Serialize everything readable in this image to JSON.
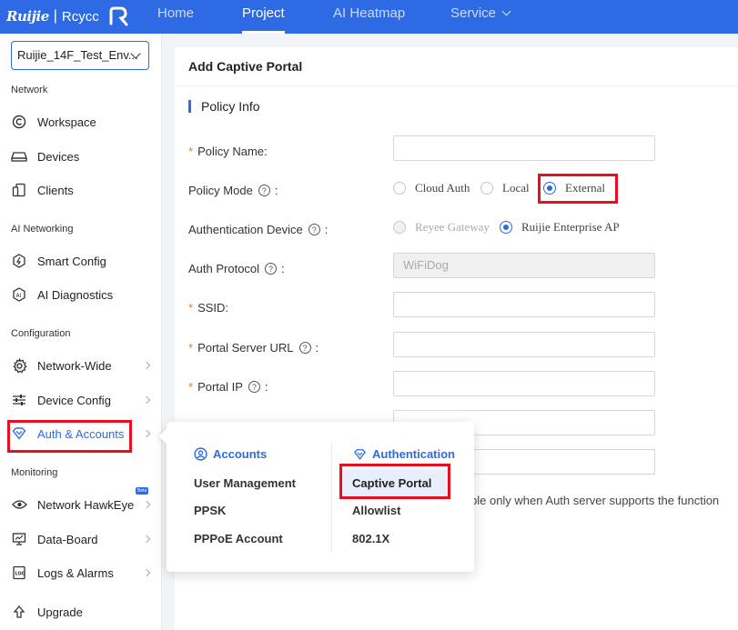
{
  "topbar": {
    "brand": "Ruijie",
    "brand2": "Rcycc",
    "nav": [
      {
        "label": "Home"
      },
      {
        "label": "Project"
      },
      {
        "label": "AI Heatmap"
      },
      {
        "label": "Service"
      }
    ],
    "active_nav": "Project"
  },
  "sidebar": {
    "project_select": "Ruijie_14F_Test_Env...",
    "sections": {
      "network": "Network",
      "ai_networking": "AI Networking",
      "configuration": "Configuration",
      "monitoring": "Monitoring"
    },
    "items": [
      {
        "label": "Workspace",
        "icon": "workspace-icon"
      },
      {
        "label": "Devices",
        "icon": "devices-icon"
      },
      {
        "label": "Clients",
        "icon": "clients-icon"
      },
      {
        "label": "Smart Config",
        "icon": "smart-config-icon"
      },
      {
        "label": "AI Diagnostics",
        "icon": "ai-diagnostics-icon"
      },
      {
        "label": "Network-Wide",
        "icon": "gear-icon"
      },
      {
        "label": "Device Config",
        "icon": "sliders-icon"
      },
      {
        "label": "Auth & Accounts",
        "icon": "shield-icon"
      },
      {
        "label": "Network HawkEye",
        "icon": "eye-icon",
        "badge": "Beta"
      },
      {
        "label": "Data-Board",
        "icon": "monitor-icon"
      },
      {
        "label": "Logs & Alarms",
        "icon": "log-icon"
      },
      {
        "label": "Upgrade",
        "icon": "upgrade-icon"
      }
    ]
  },
  "panel": {
    "title": "Add Captive Portal",
    "section": "Policy Info",
    "fields": {
      "policy_name": "Policy Name",
      "policy_mode": "Policy Mode",
      "auth_device": "Authentication Device",
      "auth_protocol": "Auth Protocol",
      "ssid": "SSID",
      "portal_url": "Portal Server URL",
      "portal_ip": "Portal IP"
    },
    "colon": ":",
    "policy_mode_options": [
      "Cloud Auth",
      "Local",
      "External"
    ],
    "policy_mode_selected": "External",
    "auth_device_options": [
      "Reyee Gateway",
      "Ruijie Enterprise AP"
    ],
    "auth_device_selected": "Ruijie Enterprise AP",
    "auth_protocol_value": "WiFiDog",
    "hint_text": "ble only when Auth server supports the function"
  },
  "popup": {
    "accounts_header": "Accounts",
    "accounts_items": [
      "User Management",
      "PPSK",
      "PPPoE Account"
    ],
    "auth_header": "Authentication",
    "auth_items": [
      "Captive Portal",
      "Allowlist",
      "802.1X"
    ],
    "auth_selected": "Captive Portal"
  },
  "colors": {
    "primary": "#2d6ae3",
    "highlight_box": "#e5101f",
    "required": "#f27a14"
  }
}
